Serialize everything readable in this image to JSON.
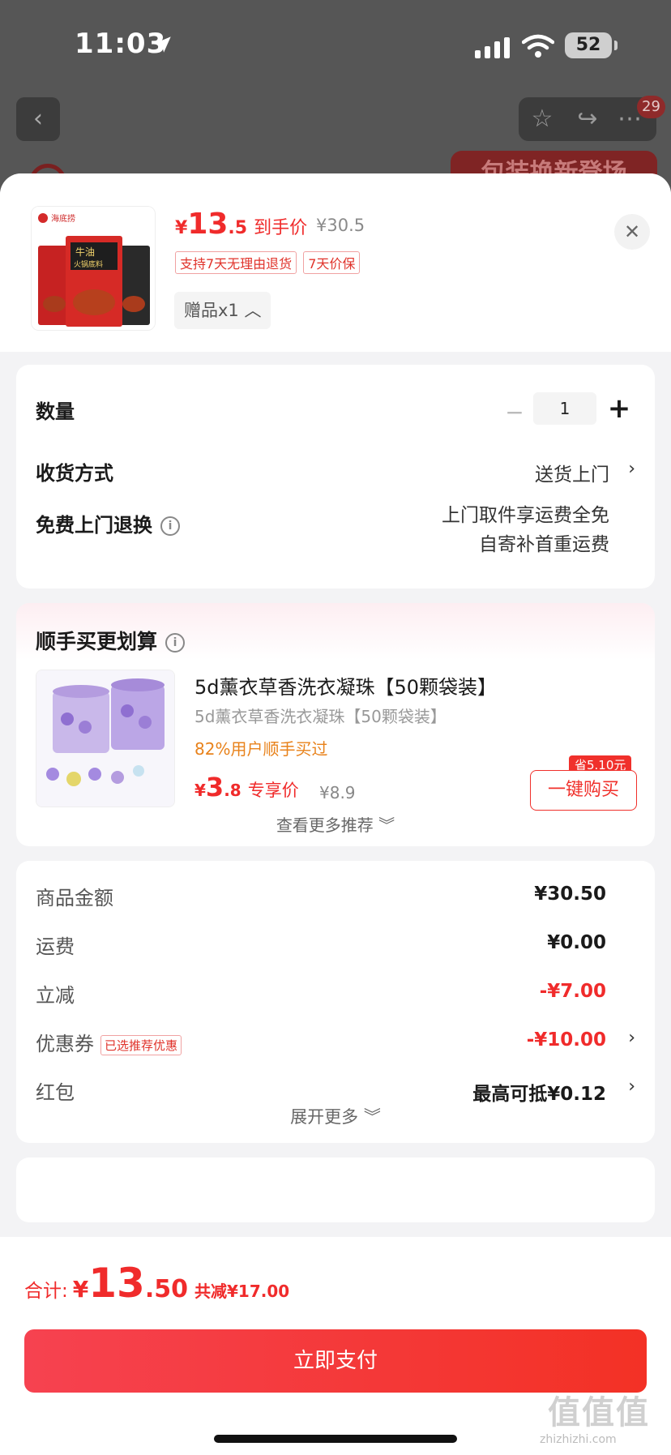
{
  "status": {
    "time": "11:03",
    "battery": "52"
  },
  "nav": {
    "badge": "29"
  },
  "bg": {
    "banner": "包装换新登场"
  },
  "product": {
    "price_symbol": "¥",
    "price_int": "13",
    "price_dec": ".5",
    "price_tag": "到手价",
    "original_price": "¥30.5",
    "tags": [
      "支持7天无理由退货",
      "7天价保"
    ],
    "gift": "赠品x1 ︿",
    "thumb_text": [
      "海底捞",
      "牛油",
      "火锅底料"
    ]
  },
  "options": {
    "quantity_label": "数量",
    "quantity_value": "1",
    "minus": "−",
    "plus": "+",
    "delivery_label": "收货方式",
    "delivery_value": "送货上门",
    "return_label": "免费上门退换",
    "return_line1": "上门取件享运费全免",
    "return_line2": "自寄补首重运费"
  },
  "recommend": {
    "title": "顺手买更划算",
    "item_title": "5d薰衣草香洗衣凝珠【50颗袋装】",
    "item_sub": "5d薰衣草香洗衣凝珠【50颗袋装】",
    "item_hot": "82%用户顺手买过",
    "price_symbol": "¥",
    "price_int": "3",
    "price_dec": ".8",
    "price_tag": "专享价",
    "original_price": "¥8.9",
    "save_badge": "省5.10元",
    "buy_button": "一键购买",
    "see_more": "查看更多推荐 ︾"
  },
  "fees": {
    "rows": [
      {
        "label": "商品金额",
        "value": "¥30.50"
      },
      {
        "label": "运费",
        "value": "¥0.00"
      },
      {
        "label": "立减",
        "value": "-¥7.00"
      },
      {
        "label": "优惠券",
        "value": "-¥10.00",
        "tag": "已选推荐优惠"
      },
      {
        "label": "红包",
        "value": "最高可抵¥0.12"
      }
    ],
    "expand_more": "展开更多 ︾"
  },
  "footer": {
    "total_label": "合计:",
    "total_symbol": "¥",
    "total_int": "13",
    "total_dec": ".50",
    "total_save": "共减¥17.00",
    "pay_button": "立即支付"
  },
  "watermark": {
    "main": "值值值",
    "sub": "zhizhizhi.com"
  },
  "colors": {
    "accent": "#f02b2b",
    "hot": "#e8821b",
    "pay_start": "#f64250",
    "pay_end": "#f33125"
  }
}
